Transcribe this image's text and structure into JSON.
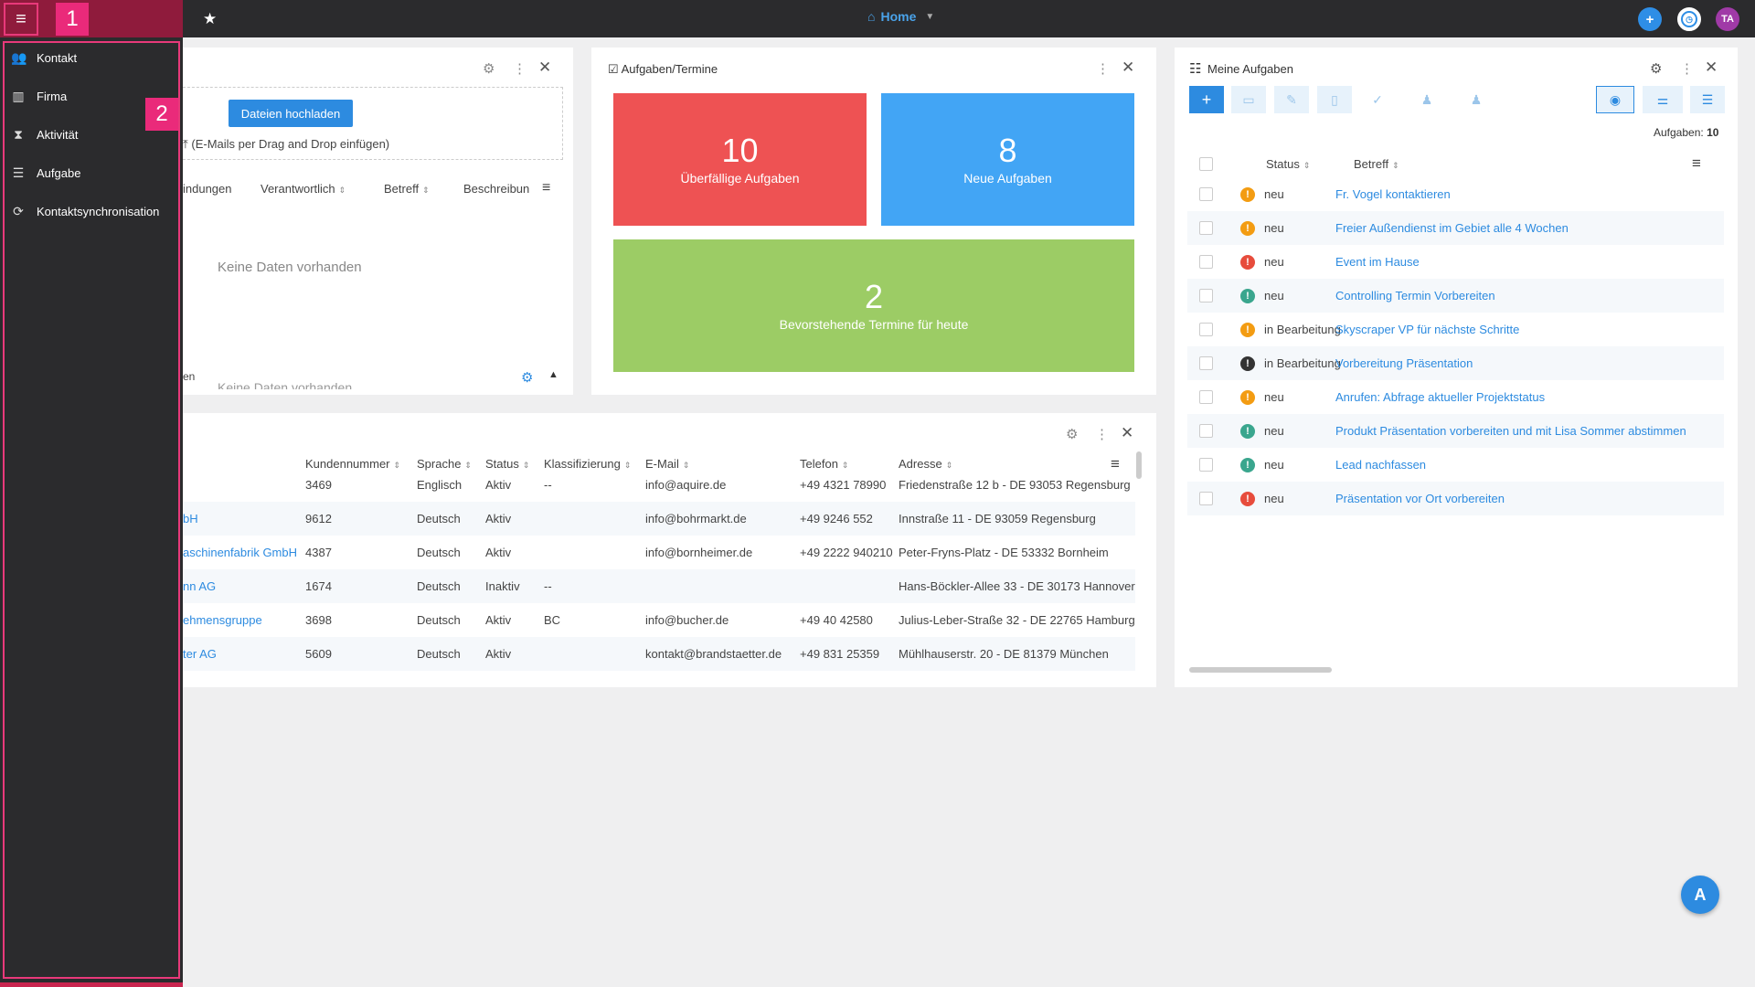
{
  "topbar": {
    "home_label": "Home",
    "avatar_initials": "TA"
  },
  "annotations": {
    "badge1": "1",
    "badge2": "2"
  },
  "sidebar": {
    "items": [
      {
        "label": "Kontakt",
        "icon": "contacts-icon"
      },
      {
        "label": "Firma",
        "icon": "building-icon"
      },
      {
        "label": "Aktivität",
        "icon": "hourglass-icon"
      },
      {
        "label": "Aufgabe",
        "icon": "task-list-icon"
      },
      {
        "label": "Kontaktsynchronisation",
        "icon": "sync-icon"
      }
    ]
  },
  "documents_panel": {
    "upload_label": "Dateien hochladen",
    "dropzone_text": "(E-Mails per Drag and Drop einfügen)",
    "columns": [
      "indungen",
      "Verantwortlich",
      "Betreff",
      "Beschreibun"
    ],
    "empty_text": "Keine Daten vorhanden",
    "second_section_partial": "en",
    "empty_text_2": "Keine Daten vorhanden"
  },
  "tasks_panel": {
    "title": "Aufgaben/Termine",
    "tiles": [
      {
        "number": "10",
        "label": "Überfällige Aufgaben",
        "color": "#ee5253"
      },
      {
        "number": "8",
        "label": "Neue Aufgaben",
        "color": "#42a5f5"
      },
      {
        "number": "2",
        "label": "Bevorstehende Termine für heute",
        "color": "#9ccc65"
      }
    ]
  },
  "companies_panel": {
    "headers": [
      "Kundennummer",
      "Sprache",
      "Status",
      "Klassifizierung",
      "E-Mail",
      "Telefon",
      "Adresse"
    ],
    "rows": [
      {
        "name": "",
        "nr": "3469",
        "lang": "Englisch",
        "status": "Aktiv",
        "class": "--",
        "email": "info@aquire.de",
        "tel": "+49 4321 78990",
        "addr": "Friedenstraße 12 b - DE 93053 Regensburg"
      },
      {
        "name": "bH",
        "nr": "9612",
        "lang": "Deutsch",
        "status": "Aktiv",
        "class": "",
        "email": "info@bohrmarkt.de",
        "tel": "+49 9246 552",
        "addr": "Innstraße 11 - DE 93059 Regensburg"
      },
      {
        "name": "aschinenfabrik GmbH",
        "nr": "4387",
        "lang": "Deutsch",
        "status": "Aktiv",
        "class": "",
        "email": "info@bornheimer.de",
        "tel": "+49 2222 940210",
        "addr": "Peter-Fryns-Platz - DE 53332 Bornheim"
      },
      {
        "name": "nn AG",
        "nr": "1674",
        "lang": "Deutsch",
        "status": "Inaktiv",
        "class": "--",
        "email": "",
        "tel": "",
        "addr": "Hans-Böckler-Allee 33 - DE 30173 Hannover"
      },
      {
        "name": "ehmensgruppe",
        "nr": "3698",
        "lang": "Deutsch",
        "status": "Aktiv",
        "class": "BC",
        "email": "info@bucher.de",
        "tel": "+49 40 42580",
        "addr": "Julius-Leber-Straße 32 - DE 22765 Hamburg"
      },
      {
        "name": "ter AG",
        "nr": "5609",
        "lang": "Deutsch",
        "status": "Aktiv",
        "class": "",
        "email": "kontakt@brandstaetter.de",
        "tel": "+49 831 25359",
        "addr": "Mühlhauserstr. 20 - DE 81379 München"
      }
    ]
  },
  "my_tasks_panel": {
    "title": "Meine Aufgaben",
    "count_label": "Aufgaben:",
    "count_value": "10",
    "headers": {
      "status": "Status",
      "subject": "Betreff"
    },
    "rows": [
      {
        "status": "neu",
        "subject": "Fr. Vogel kontaktieren",
        "prio_color": "#f39c12"
      },
      {
        "status": "neu",
        "subject": "Freier Außendienst im Gebiet alle 4 Wochen",
        "prio_color": "#f39c12"
      },
      {
        "status": "neu",
        "subject": "Event im Hause",
        "prio_color": "#e74c3c"
      },
      {
        "status": "neu",
        "subject": "Controlling Termin Vorbereiten",
        "prio_color": "#3aa68e"
      },
      {
        "status": "in Bearbeitung",
        "subject": "Skyscraper VP für nächste Schritte",
        "prio_color": "#f39c12"
      },
      {
        "status": "in Bearbeitung",
        "subject": "Vorbereitung Präsentation",
        "prio_color": "#333333"
      },
      {
        "status": "neu",
        "subject": "Anrufen: Abfrage aktueller Projektstatus",
        "prio_color": "#f39c12"
      },
      {
        "status": "neu",
        "subject": "Produkt Präsentation vorbereiten und mit Lisa Sommer abstimmen",
        "prio_color": "#3aa68e"
      },
      {
        "status": "neu",
        "subject": "Lead nachfassen",
        "prio_color": "#3aa68e"
      },
      {
        "status": "neu",
        "subject": "Präsentation vor Ort vorbereiten",
        "prio_color": "#e74c3c"
      }
    ]
  }
}
